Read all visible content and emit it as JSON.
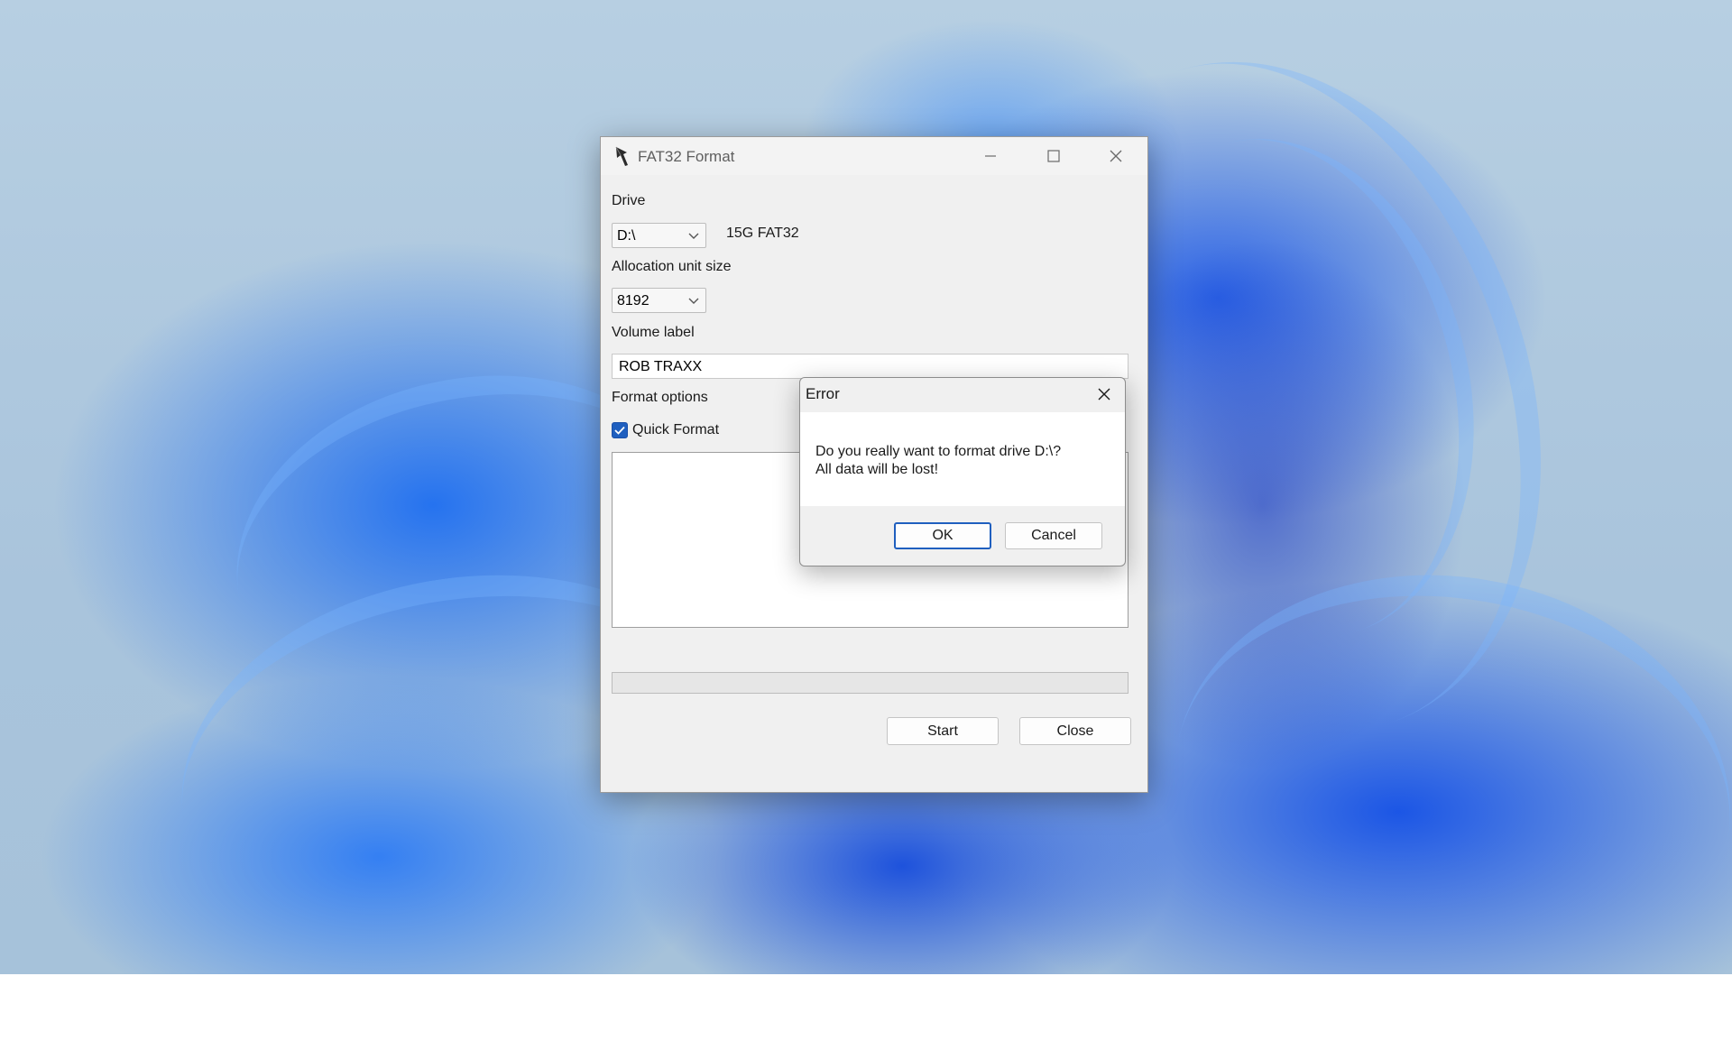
{
  "window": {
    "title": "FAT32 Format",
    "drive_label": "Drive",
    "drive_value": "D:\\",
    "drive_info": "15G FAT32",
    "alloc_label": "Allocation unit size",
    "alloc_value": "8192",
    "volume_label": "Volume label",
    "volume_value": "ROB TRAXX",
    "format_options_label": "Format options",
    "quick_format_label": "Quick Format",
    "quick_format_checked": true,
    "log_text": "",
    "progress_fraction": 0,
    "start_label": "Start",
    "close_label": "Close"
  },
  "dialog": {
    "title": "Error",
    "message_line1": "Do you really want to format drive D:\\?",
    "message_line2": "All data will be lost!",
    "ok_label": "OK",
    "cancel_label": "Cancel"
  },
  "icons": {
    "app": "format-app-icon",
    "minimize": "minimize-icon",
    "maximize": "maximize-icon",
    "close": "close-icon",
    "dropdown": "chevron-down-icon",
    "check": "checkmark-icon"
  },
  "colors": {
    "accent": "#1f5fbf",
    "wallpaper": "#1a5ce6"
  }
}
